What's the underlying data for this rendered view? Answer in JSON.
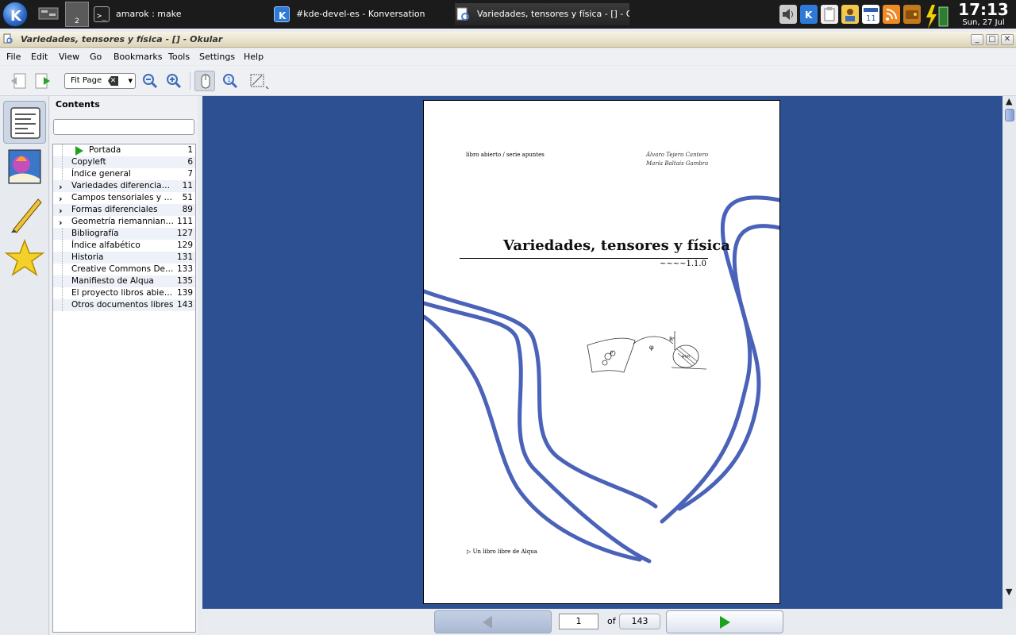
{
  "taskbar": {
    "pager_number": "2",
    "tasks": [
      {
        "label": "amarok : make",
        "icon": "terminal-icon"
      },
      {
        "label": "#kde-devel-es - Konversation",
        "icon": "konversation-icon"
      },
      {
        "label": "Variedades, tensores y física - [] - Okul",
        "icon": "okular-icon"
      }
    ],
    "tray_icons": [
      "volume-icon",
      "kde-icon",
      "clipboard-icon",
      "user-icon",
      "calendar-icon",
      "rss-icon",
      "wallet-icon",
      "battery-icon"
    ],
    "clock": {
      "time": "17:13",
      "date": "Sun, 27 Jul"
    }
  },
  "window": {
    "title": "Variedades, tensores y física - [] - Okular",
    "buttons": {
      "minimize": "_",
      "maximize": "□",
      "close": "✕"
    }
  },
  "menu": [
    "File",
    "Edit",
    "View",
    "Go",
    "Bookmarks",
    "Tools",
    "Settings",
    "Help"
  ],
  "toolbar": {
    "zoom_value": "Fit Page"
  },
  "sidebar": {
    "contents_title": "Contents",
    "search_placeholder": "",
    "toc": [
      {
        "label": "Portada",
        "page": "1",
        "expandable": false,
        "current": true
      },
      {
        "label": "Copyleft",
        "page": "6",
        "expandable": false
      },
      {
        "label": "Índice general",
        "page": "7",
        "expandable": false
      },
      {
        "label": "Variedades diferenciables",
        "page": "11",
        "expandable": true
      },
      {
        "label": "Campos tensoriales y de...",
        "page": "51",
        "expandable": true
      },
      {
        "label": "Formas diferenciales",
        "page": "89",
        "expandable": true
      },
      {
        "label": "Geometría riemanniana...",
        "page": "111",
        "expandable": true
      },
      {
        "label": "Bibliografía",
        "page": "127",
        "expandable": false
      },
      {
        "label": "Índice alfabético",
        "page": "129",
        "expandable": false
      },
      {
        "label": "Historia",
        "page": "131",
        "expandable": false
      },
      {
        "label": "Creative Commons Deed",
        "page": "133",
        "expandable": false
      },
      {
        "label": "Manifiesto de Alqua",
        "page": "135",
        "expandable": false
      },
      {
        "label": "El proyecto libros abiert...",
        "page": "139",
        "expandable": false
      },
      {
        "label": "Otros documentos libres",
        "page": "143",
        "expandable": false
      }
    ]
  },
  "document_page": {
    "series": "libro abierto / serie apuntes",
    "authors": [
      "Álvaro Tejero Cantero",
      "María Baltais Gambra"
    ],
    "title": "Variedades, tensores y física",
    "version": "~~~~1.1.0",
    "footer": "▷ Un libro libre de Alqua",
    "figure_labels": {
      "phi": "φ",
      "rn": "ℝⁿ",
      "phi_p": "φ(p)",
      "p": "p"
    }
  },
  "navigation": {
    "current_page": "1",
    "of_label": "of",
    "total_pages": "143"
  },
  "colors": {
    "viewer_bg": "#2c5092",
    "page_curve": "#4a62b8",
    "accent_green": "#1ea11e"
  }
}
